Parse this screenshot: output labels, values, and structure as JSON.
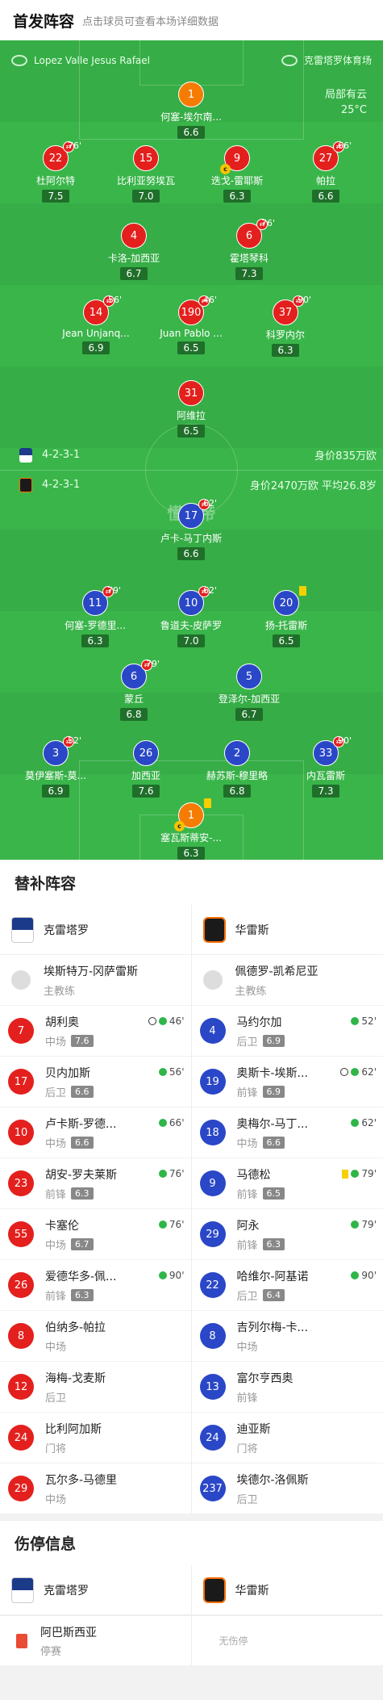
{
  "header": {
    "title": "首发阵容",
    "subtitle": "点击球员可查看本场详细数据"
  },
  "pitch": {
    "referee": "Lopez Valle Jesus Rafael",
    "stadium": "克雷塔罗体育场",
    "weather": "局部有云",
    "temperature": "25°C",
    "watermark": "懂球帝",
    "home": {
      "formation": "4-2-3-1",
      "value": "身价835万欧"
    },
    "away": {
      "formation": "4-2-3-1",
      "value": "身价2470万欧 平均26.8岁"
    }
  },
  "home_players": [
    {
      "num": "1",
      "name": "何塞-埃尔南...",
      "rating": "6.6"
    },
    {
      "num": "22",
      "name": "杜阿尔特",
      "rating": "7.5",
      "time": "76'"
    },
    {
      "num": "15",
      "name": "比利亚努埃瓦",
      "rating": "7.0"
    },
    {
      "num": "9",
      "name": "迭戈-雷耶斯",
      "rating": "6.3"
    },
    {
      "num": "27",
      "name": "帕拉",
      "rating": "6.6",
      "time": "66'"
    },
    {
      "num": "4",
      "name": "卡洛-加西亚",
      "rating": "6.7"
    },
    {
      "num": "6",
      "name": "霍塔琴科",
      "rating": "7.3",
      "time": "76'"
    },
    {
      "num": "14",
      "name": "Jean Unjanq...",
      "rating": "6.9",
      "time": "56'"
    },
    {
      "num": "190",
      "name": "Juan Pablo ...",
      "rating": "6.5",
      "time": "46'"
    },
    {
      "num": "37",
      "name": "科罗内尔",
      "rating": "6.3",
      "time": "90'"
    },
    {
      "num": "31",
      "name": "阿维拉",
      "rating": "6.5"
    }
  ],
  "away_players": [
    {
      "num": "17",
      "name": "卢卡-马丁内斯",
      "rating": "6.6",
      "time": "62'"
    },
    {
      "num": "11",
      "name": "何塞-罗德里...",
      "rating": "6.3",
      "time": "79'"
    },
    {
      "num": "10",
      "name": "鲁道夫-皮萨罗",
      "rating": "7.0",
      "time": "62'"
    },
    {
      "num": "20",
      "name": "扬-托雷斯",
      "rating": "6.5"
    },
    {
      "num": "6",
      "name": "蒙丘",
      "rating": "6.8",
      "time": "79'"
    },
    {
      "num": "5",
      "name": "登泽尔-加西亚",
      "rating": "6.7"
    },
    {
      "num": "3",
      "name": "莫伊塞斯-莫...",
      "rating": "6.9",
      "time": "52'"
    },
    {
      "num": "26",
      "name": "加西亚",
      "rating": "7.6"
    },
    {
      "num": "2",
      "name": "赫苏斯-穆里略",
      "rating": "6.8"
    },
    {
      "num": "33",
      "name": "内瓦雷斯",
      "rating": "7.3",
      "time": "90'"
    },
    {
      "num": "1",
      "name": "塞瓦斯蒂安-...",
      "rating": "6.3"
    }
  ],
  "subs": {
    "title": "替补阵容",
    "home_team": "克雷塔罗",
    "away_team": "华雷斯",
    "home_coach": {
      "name": "埃斯特万-冈萨雷斯",
      "role": "主教练"
    },
    "away_coach": {
      "name": "佩德罗-凯希尼亚",
      "role": "主教练"
    },
    "home": [
      {
        "num": "7",
        "name": "胡利奥",
        "pos": "中场",
        "rating": "7.6",
        "time": "46'"
      },
      {
        "num": "17",
        "name": "贝内加斯",
        "pos": "后卫",
        "rating": "6.6",
        "time": "56'"
      },
      {
        "num": "10",
        "name": "卢卡斯-罗德...",
        "pos": "中场",
        "rating": "6.6",
        "time": "66'"
      },
      {
        "num": "23",
        "name": "胡安-罗夫莱斯",
        "pos": "前锋",
        "rating": "6.3",
        "time": "76'"
      },
      {
        "num": "55",
        "name": "卡塞伦",
        "pos": "中场",
        "rating": "6.7",
        "time": "76'"
      },
      {
        "num": "26",
        "name": "爱德华多-佩...",
        "pos": "前锋",
        "rating": "6.3",
        "time": "90'"
      },
      {
        "num": "8",
        "name": "伯纳多-帕拉",
        "pos": "中场"
      },
      {
        "num": "12",
        "name": "海梅-戈麦斯",
        "pos": "后卫"
      },
      {
        "num": "24",
        "name": "比利阿加斯",
        "pos": "门将"
      },
      {
        "num": "29",
        "name": "瓦尔多-马德里",
        "pos": "中场"
      }
    ],
    "away": [
      {
        "num": "4",
        "name": "马约尔加",
        "pos": "后卫",
        "rating": "6.9",
        "time": "52'"
      },
      {
        "num": "19",
        "name": "奥斯卡-埃斯...",
        "pos": "前锋",
        "rating": "6.9",
        "time": "62'"
      },
      {
        "num": "18",
        "name": "奥梅尔-马丁...",
        "pos": "中场",
        "rating": "6.6",
        "time": "62'"
      },
      {
        "num": "9",
        "name": "马德松",
        "pos": "前锋",
        "rating": "6.5",
        "time": "79'"
      },
      {
        "num": "29",
        "name": "阿永",
        "pos": "前锋",
        "rating": "6.3",
        "time": "79'"
      },
      {
        "num": "22",
        "name": "哈维尔-阿基诺",
        "pos": "后卫",
        "rating": "6.4",
        "time": "90'"
      },
      {
        "num": "8",
        "name": "吉列尔梅-卡...",
        "pos": "中场"
      },
      {
        "num": "13",
        "name": "富尔亨西奥",
        "pos": "前锋"
      },
      {
        "num": "24",
        "name": "迪亚斯",
        "pos": "门将"
      },
      {
        "num": "237",
        "name": "埃德尔-洛佩斯",
        "pos": "后卫"
      }
    ]
  },
  "injury": {
    "title": "伤停信息",
    "home_player": "阿巴斯西亚",
    "home_status": "停赛",
    "away_none": "无伤停"
  },
  "colors": {
    "pitch": "#3ab54a",
    "home": "#e3201d",
    "away": "#2a47c7",
    "gk_home": "#f57c00"
  }
}
